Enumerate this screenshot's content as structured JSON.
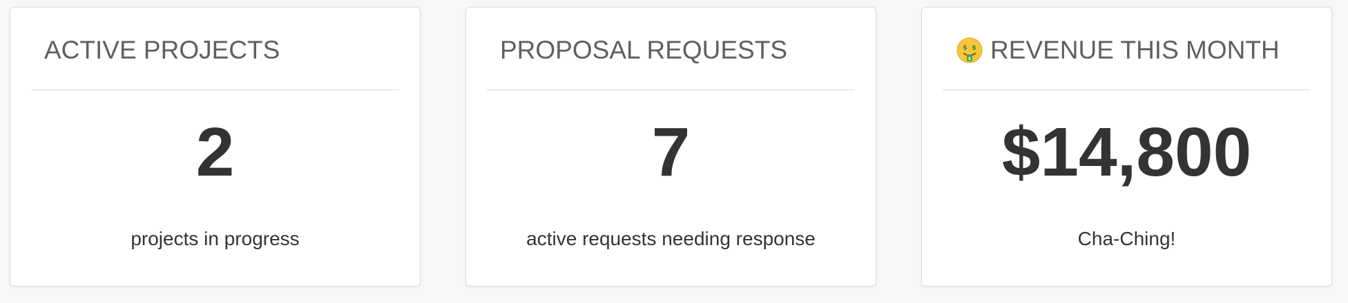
{
  "cards": [
    {
      "title": "ACTIVE PROJECTS",
      "value": "2",
      "caption": "projects in progress"
    },
    {
      "title": "PROPOSAL REQUESTS",
      "value": "7",
      "caption": "active requests needing response"
    },
    {
      "title": "REVENUE THIS MONTH",
      "icon": "money-mouth-face-icon",
      "value": "$14,800",
      "caption": "Cha-Ching!"
    }
  ],
  "colors": {
    "page_background": "#f8f7f5",
    "card_background": "#ffffff",
    "title_text": "#5f5f5f",
    "value_text": "#333333",
    "divider": "#d8d8d8"
  }
}
